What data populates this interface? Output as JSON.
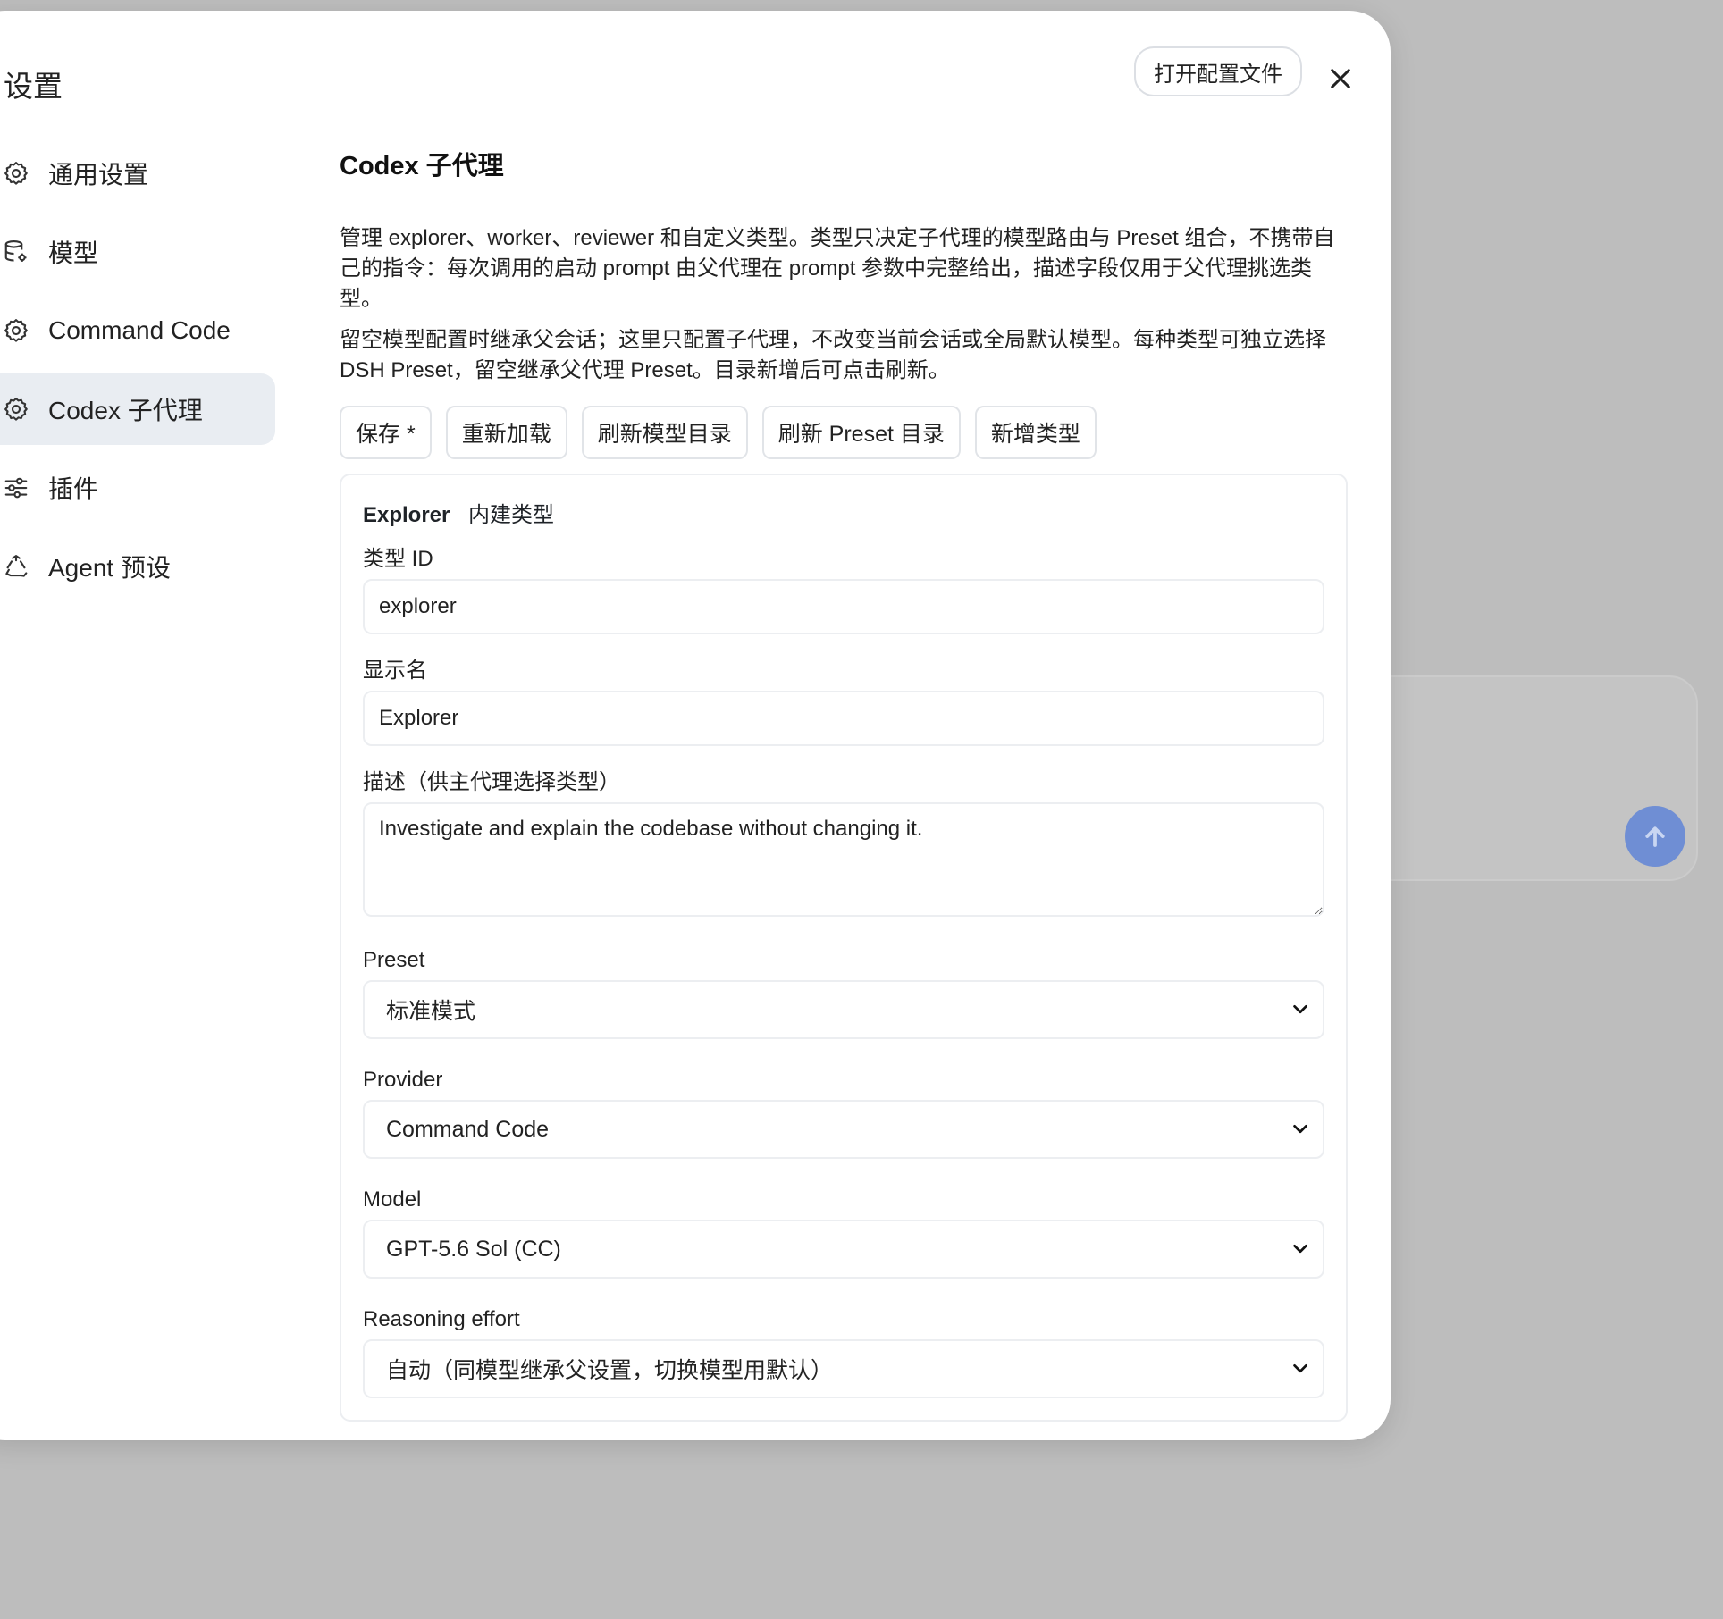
{
  "modal": {
    "title": "设置",
    "open_config_label": "打开配置文件"
  },
  "sidebar": {
    "items": [
      {
        "label": "通用设置",
        "icon": "gear-icon"
      },
      {
        "label": "模型",
        "icon": "database-gear-icon"
      },
      {
        "label": "Command Code",
        "icon": "gear-icon"
      },
      {
        "label": "Codex 子代理",
        "icon": "gear-icon",
        "active": true
      },
      {
        "label": "插件",
        "icon": "sliders-icon"
      },
      {
        "label": "Agent 预设",
        "icon": "recycle-icon"
      }
    ]
  },
  "main": {
    "title": "Codex 子代理",
    "description_1": "管理 explorer、worker、reviewer 和自定义类型。类型只决定子代理的模型路由与 Preset 组合，不携带自己的指令：每次调用的启动 prompt 由父代理在 prompt 参数中完整给出，描述字段仅用于父代理挑选类型。",
    "description_2": "留空模型配置时继承父会话；这里只配置子代理，不改变当前会话或全局默认模型。每种类型可独立选择 DSH Preset，留空继承父代理 Preset。目录新增后可点击刷新。",
    "toolbar": {
      "save": "保存 *",
      "reload": "重新加载",
      "refresh_models": "刷新模型目录",
      "refresh_presets": "刷新 Preset 目录",
      "add_type": "新增类型"
    },
    "type_card": {
      "name": "Explorer",
      "badge": "内建类型",
      "id_label": "类型 ID",
      "id_value": "explorer",
      "display_label": "显示名",
      "display_value": "Explorer",
      "desc_label": "描述（供主代理选择类型）",
      "desc_value": "Investigate and explain the codebase without changing it.",
      "preset_label": "Preset",
      "preset_value": "标准模式",
      "provider_label": "Provider",
      "provider_value": "Command Code",
      "model_label": "Model",
      "model_value": "GPT-5.6 Sol (CC)",
      "effort_label": "Reasoning effort",
      "effort_value": "自动（同模型继承父设置，切换模型用默认）"
    }
  },
  "colors": {
    "backdrop": "#bdbdbd",
    "active_item": "#e9edf2",
    "send_button": "#6f8ed4"
  }
}
